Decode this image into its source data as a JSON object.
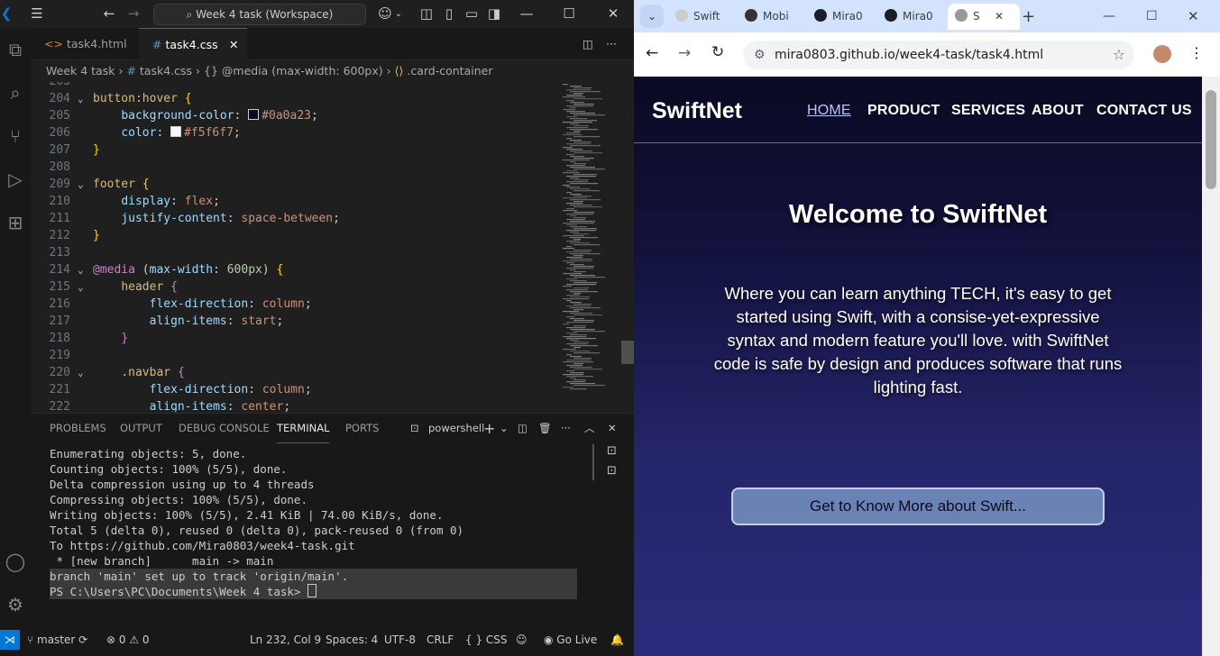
{
  "vscode": {
    "title": "Week 4 task (Workspace)",
    "tabs": [
      {
        "label": "task4.html",
        "icon": "<>",
        "active": false
      },
      {
        "label": "task4.css",
        "icon": "#",
        "active": true
      }
    ],
    "breadcrumb": [
      "Week 4 task",
      "task4.css",
      "{} @media (max-width: 600px)",
      ".card-container"
    ],
    "code_lines": [
      {
        "n": "203",
        "html": ""
      },
      {
        "n": "204",
        "html": "<span class='sel'>button:hover</span> <span class='brk'>{</span>"
      },
      {
        "n": "205",
        "html": "    <span class='prop'>background-color</span>: <span class='swatch' style='background:#0a0a23'></span><span class='val'>#0a0a23</span>;"
      },
      {
        "n": "206",
        "html": "    <span class='prop'>color</span>: <span class='swatch' style='background:#f5f6f7'></span><span class='val'>#f5f6f7</span>;"
      },
      {
        "n": "207",
        "html": "<span class='brk'>}</span>"
      },
      {
        "n": "208",
        "html": ""
      },
      {
        "n": "209",
        "html": "<span class='sel'>footer</span> <span class='brk'>{</span>"
      },
      {
        "n": "210",
        "html": "    <span class='prop'>display</span>: <span class='val'>flex</span>;"
      },
      {
        "n": "211",
        "html": "    <span class='prop'>justify-content</span>: <span class='val'>space-between</span>;"
      },
      {
        "n": "212",
        "html": "<span class='brk'>}</span>"
      },
      {
        "n": "213",
        "html": ""
      },
      {
        "n": "214",
        "html": "<span class='at'>@media</span> (<span class='prop'>max-width</span>: <span class='num'>600px</span>) <span class='brk'>{</span>"
      },
      {
        "n": "215",
        "html": "    <span class='sel'>header</span> <span class='at'>{</span>"
      },
      {
        "n": "216",
        "html": "        <span class='prop'>flex-direction</span>: <span class='val'>column</span>;"
      },
      {
        "n": "217",
        "html": "        <span class='prop'>align-items</span>: <span class='val'>start</span>;"
      },
      {
        "n": "218",
        "html": "    <span class='at'>}</span>"
      },
      {
        "n": "219",
        "html": ""
      },
      {
        "n": "220",
        "html": "    <span class='sel'>.navbar</span> <span class='at'>{</span>"
      },
      {
        "n": "221",
        "html": "        <span class='prop'>flex-direction</span>: <span class='val'>column</span>;"
      },
      {
        "n": "222",
        "html": "        <span class='prop'>align-items</span>: <span class='val'>center</span>;"
      }
    ],
    "panel_tabs": [
      "PROBLEMS",
      "OUTPUT",
      "DEBUG CONSOLE",
      "TERMINAL",
      "PORTS"
    ],
    "shell": "powershell",
    "terminal_lines": [
      "Enumerating objects: 5, done.",
      "Counting objects: 100% (5/5), done.",
      "Delta compression using up to 4 threads",
      "Compressing objects: 100% (5/5), done.",
      "Writing objects: 100% (5/5), 2.41 KiB | 74.00 KiB/s, done.",
      "Total 5 (delta 0), reused 0 (delta 0), pack-reused 0 (from 0)",
      "To https://github.com/Mira0803/week4-task.git",
      " * [new branch]      main -> main",
      "branch 'main' set up to track 'origin/main'.",
      "PS C:\\Users\\PC\\Documents\\Week 4 task> "
    ],
    "status": {
      "branch": "master",
      "problems": "⊗ 0 ⚠ 0",
      "position": "Ln 232, Col 9",
      "spaces": "Spaces: 4",
      "encoding": "UTF-8",
      "eol": "CRLF",
      "language": "{ } CSS",
      "golive": "Go Live"
    }
  },
  "chrome": {
    "tabs": [
      "Swift",
      "Mobi",
      "Mira0",
      "Mira0",
      "S"
    ],
    "url": "mira0803.github.io/week4-task/task4.html",
    "page": {
      "brand": "SwiftNet",
      "nav": [
        "HOME",
        "PRODUCT",
        "SERVICES",
        "ABOUT",
        "CONTACT US"
      ],
      "title": "Welcome to SwiftNet",
      "text": "Where you can learn anything TECH, it's easy to get started using Swift, with a consise-yet-expressive syntax and modern feature you'll love. with SwiftNet code is safe by design and produces software that runs lighting fast.",
      "cta": "Get to Know More about Swift..."
    }
  }
}
